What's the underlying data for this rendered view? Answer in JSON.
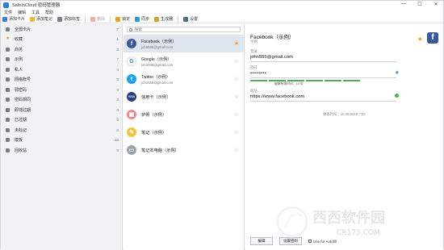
{
  "window": {
    "title": "SafeInCloud 密码管理器",
    "controls": [
      "—",
      "☐",
      "✕"
    ]
  },
  "menu": [
    "文件",
    "编辑",
    "工具",
    "帮助"
  ],
  "toolbar": {
    "add_card": "添加卡片",
    "add_note": "添加笔记",
    "add_label": "添加标签",
    "delete": "删除",
    "lock": "锁定",
    "sync": "同步",
    "generator": "生成器",
    "settings": "设置"
  },
  "sidebar": {
    "items": [
      {
        "label": "全部卡片",
        "count": "7"
      },
      {
        "label": "收藏",
        "count": "1"
      },
      {
        "label": "商务",
        "count": "3"
      },
      {
        "label": "示例",
        "count": "7"
      },
      {
        "label": "私人",
        "count": "4"
      },
      {
        "label": "网络账号",
        "count": "3"
      },
      {
        "label": "弱密码",
        "count": "3"
      },
      {
        "label": "密码相同",
        "count": "3"
      },
      {
        "label": "即将过期",
        "count": "0"
      },
      {
        "label": "已过期",
        "count": "0"
      },
      {
        "label": "未标记",
        "count": "0"
      },
      {
        "label": "模板",
        "count": "13"
      },
      {
        "label": "回收站",
        "count": "0"
      }
    ]
  },
  "search": {
    "placeholder": "搜索"
  },
  "cards": [
    {
      "title": "Facebook（示例）",
      "subtitle": "john555@gmail.com",
      "logo": "f",
      "color": "#3b5998",
      "starred": true
    },
    {
      "title": "Google（示例）",
      "subtitle": "john555@gmail.com",
      "logo": "G",
      "color": "#ffffff",
      "starred": false
    },
    {
      "title": "Twitter（示例）",
      "subtitle": "john555@gmail.com",
      "logo": "t",
      "color": "#1da1f2",
      "starred": false
    },
    {
      "title": "信用卡（示例）",
      "subtitle": "",
      "logo": "VISA",
      "color": "#2a3d7c",
      "starred": false
    },
    {
      "title": "护照（示例）",
      "subtitle": "",
      "logo": "▦",
      "color": "#e98a8a",
      "starred": false
    },
    {
      "title": "笔记（示例）",
      "subtitle": "",
      "logo": "✎",
      "color": "#f4c542",
      "starred": false
    },
    {
      "title": "笔记本电脑（示例）",
      "subtitle": "",
      "logo": "▭",
      "color": "#9aa3ad",
      "starred": false
    }
  ],
  "detail": {
    "title": "Facebook（示例）",
    "subtitle": "示例",
    "login_label": "登录",
    "login_value": "john555@gmail.com",
    "password_label": "密码",
    "password_value": "••••••••",
    "strength_label": "破解所需时间：10 年",
    "website_label": "网址",
    "website_value": "https://www.facebook.com",
    "modified": "修改时间：16.06.2019 7:52",
    "edit_button": "编辑",
    "password_button": "设置密码",
    "autofill_label": "Use for Autofill"
  },
  "watermark": {
    "brand": "西西软件园",
    "url": "CR173.COM"
  }
}
